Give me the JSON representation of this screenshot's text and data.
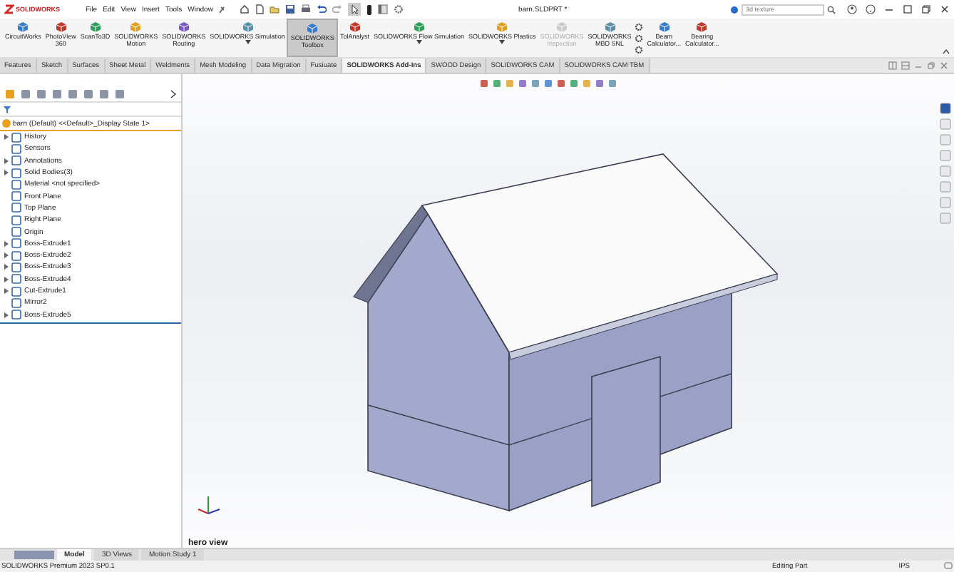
{
  "app": {
    "logo": "SOLIDWORKS",
    "menu": [
      "File",
      "Edit",
      "View",
      "Insert",
      "Tools",
      "Window"
    ],
    "title": "barn.SLDPRT *",
    "search": {
      "placeholder": "3d texture"
    }
  },
  "ribbon": [
    {
      "lines": [
        "CircuitWorks"
      ],
      "selected": false,
      "disabled": false,
      "dropdown": false
    },
    {
      "lines": [
        "PhotoView",
        "360"
      ],
      "selected": false,
      "disabled": false,
      "dropdown": false
    },
    {
      "lines": [
        "ScanTo3D"
      ],
      "selected": false,
      "disabled": false,
      "dropdown": false
    },
    {
      "lines": [
        "SOLIDWORKS",
        "Motion"
      ],
      "selected": false,
      "disabled": false,
      "dropdown": false
    },
    {
      "lines": [
        "SOLIDWORKS",
        "Routing"
      ],
      "selected": false,
      "disabled": false,
      "dropdown": false
    },
    {
      "lines": [
        "SOLIDWORKS Simulation"
      ],
      "selected": false,
      "disabled": false,
      "dropdown": true
    },
    {
      "lines": [
        "SOLIDWORKS",
        "Toolbox"
      ],
      "selected": true,
      "disabled": false,
      "dropdown": false
    },
    {
      "lines": [
        "TolAnalyst"
      ],
      "selected": false,
      "disabled": false,
      "dropdown": false
    },
    {
      "lines": [
        "SOLIDWORKS Flow Simulation"
      ],
      "selected": false,
      "disabled": false,
      "dropdown": true
    },
    {
      "lines": [
        "SOLIDWORKS Plastics"
      ],
      "selected": false,
      "disabled": false,
      "dropdown": true
    },
    {
      "lines": [
        "SOLIDWORKS",
        "Inspection"
      ],
      "selected": false,
      "disabled": true,
      "dropdown": false
    },
    {
      "lines": [
        "SOLIDWORKS",
        "MBD SNL"
      ],
      "selected": false,
      "disabled": false,
      "dropdown": false
    },
    {
      "lines": [
        "Beam",
        "Calculator..."
      ],
      "selected": false,
      "disabled": false,
      "dropdown": false
    },
    {
      "lines": [
        "Bearing",
        "Calculator..."
      ],
      "selected": false,
      "disabled": false,
      "dropdown": false
    }
  ],
  "command_tabs": [
    {
      "label": "Features",
      "selected": false
    },
    {
      "label": "Sketch",
      "selected": false
    },
    {
      "label": "Surfaces",
      "selected": false
    },
    {
      "label": "Sheet Metal",
      "selected": false
    },
    {
      "label": "Weldments",
      "selected": false
    },
    {
      "label": "Mesh Modeling",
      "selected": false
    },
    {
      "label": "Data Migration",
      "selected": false
    },
    {
      "label": "Fusiuate",
      "selected": false
    },
    {
      "label": "SOLIDWORKS Add-Ins",
      "selected": true
    },
    {
      "label": "SWOOD Design",
      "selected": false
    },
    {
      "label": "SOLIDWORKS CAM",
      "selected": false
    },
    {
      "label": "SOLIDWORKS CAM TBM",
      "selected": false
    }
  ],
  "feature_tree": {
    "label": "barn (Default) <<Default>_Display State 1>",
    "children": [
      {
        "label": "History",
        "expandable": true
      },
      {
        "label": "Sensors",
        "expandable": false
      },
      {
        "label": "Annotations",
        "expandable": true
      },
      {
        "label": "Solid Bodies(3)",
        "expandable": true
      },
      {
        "label": "Material <not specified>",
        "expandable": false
      },
      {
        "label": "Front Plane",
        "expandable": false
      },
      {
        "label": "Top Plane",
        "expandable": false
      },
      {
        "label": "Right Plane",
        "expandable": false
      },
      {
        "label": "Origin",
        "expandable": false
      },
      {
        "label": "Boss-Extrude1",
        "expandable": true
      },
      {
        "label": "Boss-Extrude2",
        "expandable": true
      },
      {
        "label": "Boss-Extrude3",
        "expandable": true
      },
      {
        "label": "Boss-Extrude4",
        "expandable": true
      },
      {
        "label": "Cut-Extrude1",
        "expandable": true
      },
      {
        "label": "Mirror2",
        "expandable": false
      },
      {
        "label": "Boss-Extrude5",
        "expandable": true
      }
    ]
  },
  "viewport": {
    "view_name": "hero view"
  },
  "bottom_tabs": [
    {
      "label": "Model",
      "selected": true
    },
    {
      "label": "3D Views",
      "selected": false
    },
    {
      "label": "Motion Study 1",
      "selected": false
    }
  ],
  "status_bar": {
    "product": "SOLIDWORKS Premium 2023 SP0.1",
    "mode": "Editing Part",
    "units": "IPS"
  }
}
